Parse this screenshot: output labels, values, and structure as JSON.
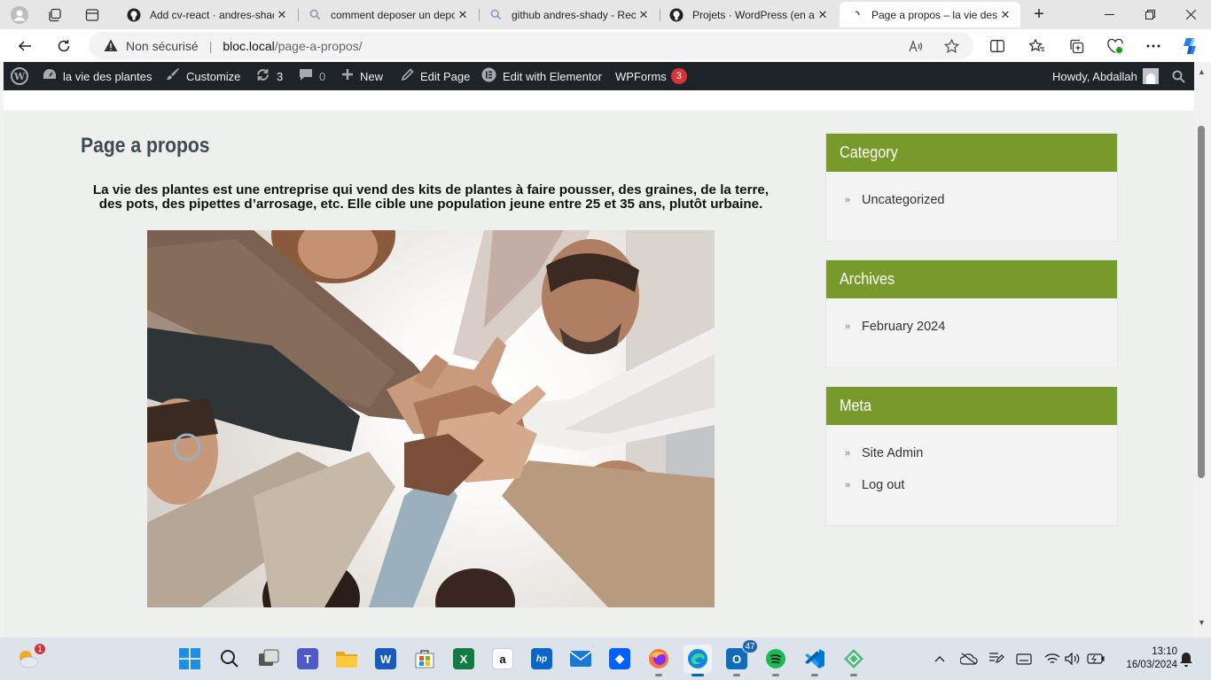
{
  "browser": {
    "tabs": [
      {
        "title": "Add cv-react · andres-shady",
        "favicon": "github-icon",
        "active": false
      },
      {
        "title": "comment deposer un depot git",
        "favicon": "search-icon",
        "active": false
      },
      {
        "title": "github andres-shady - Recherche",
        "favicon": "search-icon",
        "active": false
      },
      {
        "title": "Projets · WordPress (en anglais)",
        "favicon": "github-icon",
        "active": false
      },
      {
        "title": "Page a propos – la vie des plantes",
        "favicon": "loading-icon",
        "active": true
      }
    ],
    "security_label": "Non sécurisé",
    "url_host": "bloc.local",
    "url_path": "/page-a-propos/"
  },
  "admin_bar": {
    "site_name": "la vie des plantes",
    "customize": "Customize",
    "updates_count": "3",
    "comments_count": "0",
    "new_label": "New",
    "edit_page": "Edit Page",
    "elementor": "Edit with Elementor",
    "wpforms": "WPForms",
    "wpforms_badge": "3",
    "howdy": "Howdy, Abdallah"
  },
  "page": {
    "title": "Page a propos",
    "intro": "La vie des plantes est une entreprise qui vend des kits de plantes à faire pousser, des graines, de la terre, des pots, des pipettes d’arrosage, etc. Elle cible une population jeune entre 25 et 35 ans, plutôt urbaine."
  },
  "sidebar": {
    "category": {
      "title": "Category",
      "items": [
        "Uncategorized"
      ]
    },
    "archives": {
      "title": "Archives",
      "items": [
        "February 2024"
      ]
    },
    "meta": {
      "title": "Meta",
      "items": [
        "Site Admin",
        "Log out"
      ]
    }
  },
  "taskbar": {
    "weather_badge": "1",
    "outlook_badge": "47",
    "time": "13:10",
    "date": "16/03/2024"
  },
  "colors": {
    "widget_header": "#789a2a",
    "admin_bar": "#1d2327",
    "page_bg": "#edf0ec"
  }
}
